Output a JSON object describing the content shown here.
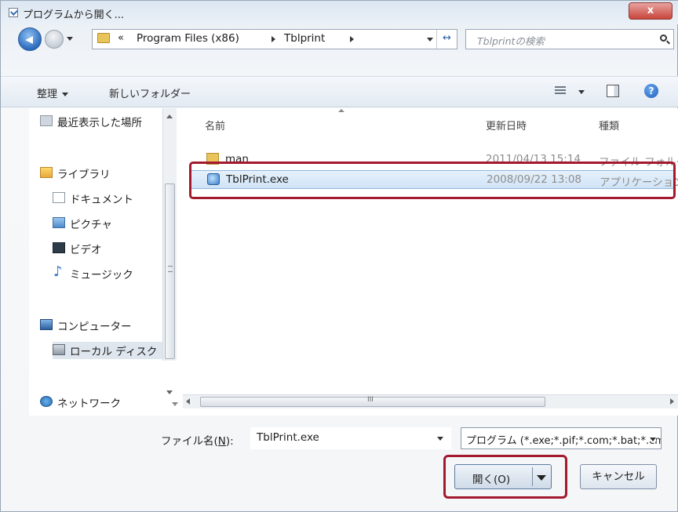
{
  "window": {
    "title": "プログラムから開く...",
    "close_label": "x"
  },
  "address": {
    "more": "«",
    "crumbs": [
      "Program Files (x86)",
      "Tblprint"
    ],
    "refresh_glyph": "↔"
  },
  "search": {
    "placeholder": "Tblprintの検索"
  },
  "toolbar": {
    "organize_label": "整理",
    "new_folder_label": "新しいフォルダー",
    "help_glyph": "?"
  },
  "sidebar": {
    "items": [
      {
        "label": "最近表示した場所",
        "icon": "recent-places-icon"
      },
      {
        "label": "ライブラリ",
        "icon": "library-icon"
      },
      {
        "label": "ドキュメント",
        "icon": "documents-icon"
      },
      {
        "label": "ピクチャ",
        "icon": "pictures-icon"
      },
      {
        "label": "ビデオ",
        "icon": "videos-icon"
      },
      {
        "label": "ミュージック",
        "icon": "music-icon"
      },
      {
        "label": "コンピューター",
        "icon": "computer-icon"
      },
      {
        "label": "ローカル ディスク",
        "icon": "local-disk-icon"
      },
      {
        "label": "ネットワーク",
        "icon": "network-icon"
      }
    ]
  },
  "filelist": {
    "columns": {
      "name": "名前",
      "date": "更新日時",
      "type": "種類"
    },
    "rows": [
      {
        "name": "man",
        "date": "2011/04/13 15:14",
        "type": "ファイル フォルダー",
        "icon": "folder-icon",
        "selected": false
      },
      {
        "name": "TblPrint.exe",
        "date": "2008/09/22 13:08",
        "type": "アプリケーション",
        "icon": "application-icon",
        "selected": true
      }
    ]
  },
  "hscroll": {
    "thumb_grip": "III"
  },
  "bottom": {
    "filename_label_pre": "ファイル名(",
    "filename_label_key": "N",
    "filename_label_post": "):",
    "filename_value": "TblPrint.exe",
    "filetype_value": "プログラム (*.exe;*.pif;*.com;*.bat;*.cmd)",
    "open_label": "開く(O)",
    "cancel_label": "キャンセル"
  },
  "colors": {
    "highlight": "#a3192e",
    "selection": "#cfe3f6",
    "accent": "#2c6bbd"
  }
}
